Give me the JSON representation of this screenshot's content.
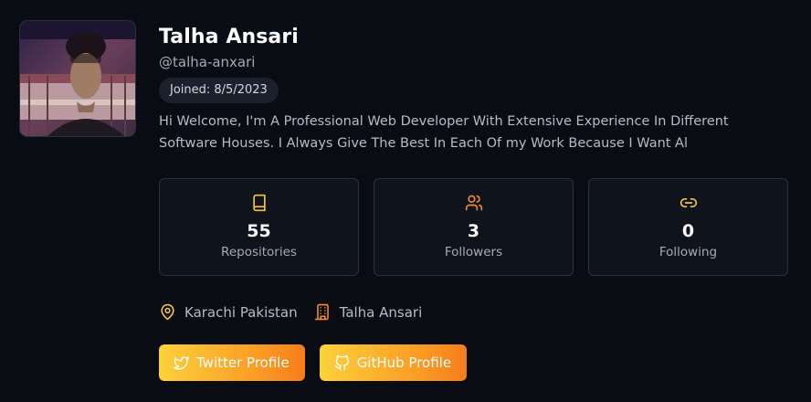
{
  "profile": {
    "name": "Talha Ansari",
    "handle": "@talha-anxari",
    "joined": "Joined: 8/5/2023",
    "bio": "Hi Welcome, I'm A Professional Web Developer With Extensive Experience In Different Software Houses. I Always Give The Best In Each Of my Work Because I Want Al"
  },
  "stats": [
    {
      "icon": "book-icon",
      "value": "55",
      "label": "Repositories"
    },
    {
      "icon": "users-icon",
      "value": "3",
      "label": "Followers"
    },
    {
      "icon": "link-icon",
      "value": "0",
      "label": "Following"
    }
  ],
  "meta": {
    "location": "Karachi Pakistan",
    "company": "Talha Ansari"
  },
  "buttons": {
    "twitter": "Twitter Profile",
    "github": "GitHub Profile"
  },
  "colors": {
    "background": "#090c12",
    "card": "#0f131b",
    "accent_yellow": "#fcd13b",
    "accent_orange": "#f77c1b"
  }
}
